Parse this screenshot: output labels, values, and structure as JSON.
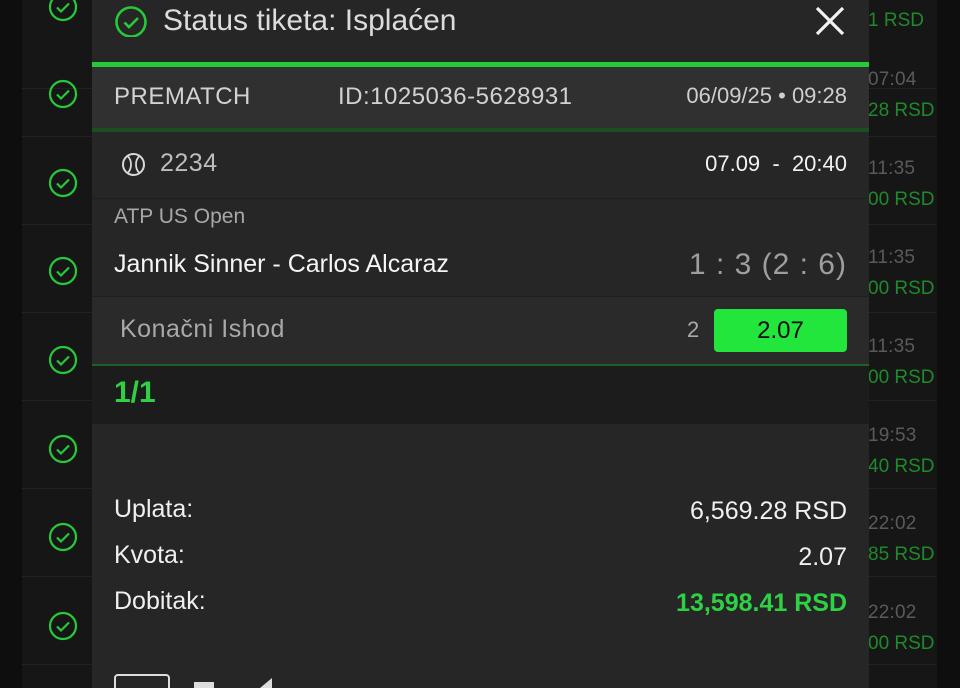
{
  "background": {
    "top_amount": "1 RSD",
    "rows": [
      {
        "time": "07:04",
        "amount": "28 RSD"
      },
      {
        "time": "11:35",
        "amount": "00 RSD"
      },
      {
        "time": "11:35",
        "amount": "00 RSD"
      },
      {
        "time": "11:35",
        "amount": "00 RSD"
      },
      {
        "time": "19:53",
        "amount": "40 RSD"
      },
      {
        "time": "22:02",
        "amount": "85 RSD"
      },
      {
        "time": "22:02",
        "amount": "00 RSD"
      }
    ]
  },
  "modal": {
    "title": "Status tiketa: Isplaćen",
    "ticket_type": "PREMATCH",
    "ticket_id": "ID:1025036-5628931",
    "ticket_datetime": "06/09/25 • 09:28",
    "event_code": "2234",
    "event_time": "07.09  -  20:40",
    "league": "ATP US Open",
    "match": "Jannik Sinner - Carlos Alcaraz",
    "score": "1 : 3 (2 : 6)",
    "market": "Konačni Ishod",
    "tip": "2",
    "odd": "2.07",
    "selection_count": "1/1",
    "stake_label": "Uplata:",
    "stake_value": "6,569.28 RSD",
    "odds_label": "Kvota:",
    "odds_value": "2.07",
    "win_label": "Dobitak:",
    "win_value": "13,598.41 RSD"
  },
  "colors": {
    "accent": "#27c93a",
    "odd_button": "#22e63c",
    "win_text": "#2fd144"
  }
}
